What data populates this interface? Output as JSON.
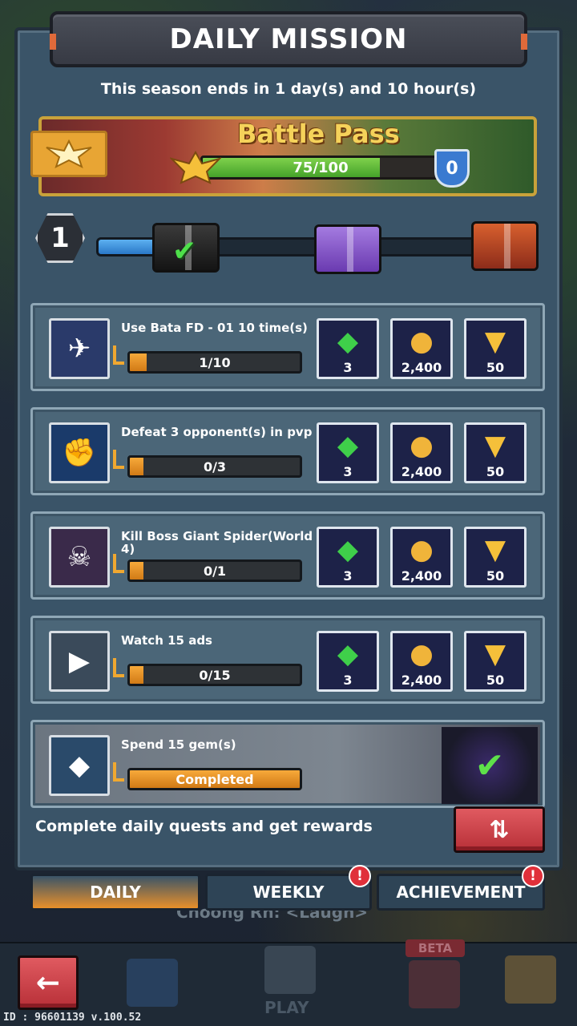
{
  "header": {
    "title": "DAILY MISSION",
    "season_text": "This season ends in 1 day(s) and 10 hour(s)"
  },
  "battle_pass": {
    "title": "Battle Pass",
    "progress_text": "75/100",
    "progress_fraction": 0.75,
    "level_shield": "0"
  },
  "track": {
    "level": "1",
    "fill_fraction": 0.16
  },
  "quests": [
    {
      "title": "Use Bata FD - 01 10 time(s)",
      "progress": "1/10",
      "fraction": 0.1,
      "rewards": [
        "3",
        "2,400",
        "50"
      ],
      "icon": "ship-icon"
    },
    {
      "title": "Defeat 3 opponent(s) in pvp",
      "progress": "0/3",
      "fraction": 0.05,
      "rewards": [
        "3",
        "2,400",
        "50"
      ],
      "icon": "fist-icon"
    },
    {
      "title": "Kill Boss Giant Spider(World 4)",
      "progress": "0/1",
      "fraction": 0.05,
      "rewards": [
        "3",
        "2,400",
        "50"
      ],
      "icon": "spider-icon"
    },
    {
      "title": "Watch 15 ads",
      "progress": "0/15",
      "fraction": 0.05,
      "rewards": [
        "3",
        "2,400",
        "50"
      ],
      "icon": "tv-icon"
    },
    {
      "title": "Spend 15 gem(s)",
      "progress": "Completed",
      "fraction": 1.0,
      "icon": "gem-hand-icon"
    }
  ],
  "footer": {
    "text": "Complete daily quests and get rewards"
  },
  "tabs": {
    "daily": "DAILY",
    "weekly": "WEEKLY",
    "achievement": "ACHIEVEMENT",
    "badge": "!"
  },
  "background": {
    "chat_text": "Choong Rn: <Laugh>"
  },
  "nav": {
    "play": "PLAY",
    "beta": "BETA"
  },
  "version": "ID : 96601139 v.100.52",
  "colors": {
    "panel": "#3a5468",
    "progress_orange": "#f0a830",
    "progress_green": "#6ccb45",
    "accent_red": "#c93a42"
  }
}
